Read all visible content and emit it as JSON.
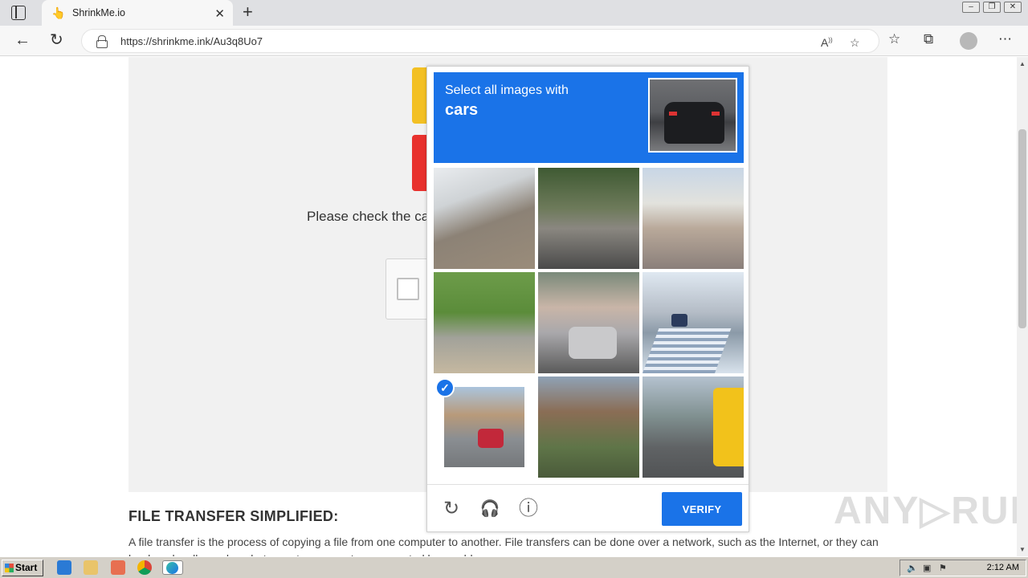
{
  "browser": {
    "tab_title": "ShrinkMe.io",
    "tab_close": "✕",
    "new_tab": "+",
    "url": "https://shrinkme.ink/Au3q8Uo7",
    "window_controls": [
      "–",
      "❐",
      "✕"
    ]
  },
  "page": {
    "check_text": "Please check the ca",
    "heading": "FILE TRANSFER SIMPLIFIED:",
    "paragraph": "A file transfer is the process of copying a file from one computer to another. File transfers can be done over a network, such as the Internet, or they can be done locally, such as between two computers connected by a cable.",
    "watermark": "ANY▷RUN"
  },
  "captcha": {
    "instruction": "Select all images with",
    "target": "cars",
    "tiles": [
      {
        "selected": false
      },
      {
        "selected": false
      },
      {
        "selected": false
      },
      {
        "selected": false
      },
      {
        "selected": false
      },
      {
        "selected": false
      },
      {
        "selected": true
      },
      {
        "selected": false
      },
      {
        "selected": false
      }
    ],
    "verify_label": "VERIFY",
    "reload_icon": "↻",
    "audio_icon": "🎧",
    "info_icon": "ⓘ",
    "check_mark": "✓"
  },
  "taskbar": {
    "start_label": "Start",
    "clock": "2:12 AM"
  },
  "colors": {
    "accent": "#1a73e8",
    "yellow_button": "#f3c023",
    "red_button": "#e8312d"
  }
}
